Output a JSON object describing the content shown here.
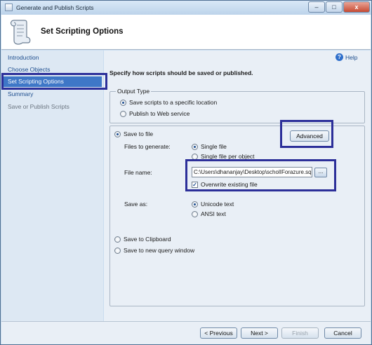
{
  "window": {
    "title": "Generate and Publish Scripts",
    "minimize_glyph": "–",
    "maximize_glyph": "□",
    "close_glyph": "x"
  },
  "header": {
    "title": "Set Scripting Options"
  },
  "sidebar": {
    "items": [
      {
        "label": "Introduction",
        "state": "link"
      },
      {
        "label": "Choose Objects",
        "state": "link"
      },
      {
        "label": "Set Scripting Options",
        "state": "active"
      },
      {
        "label": "Summary",
        "state": "link"
      },
      {
        "label": "Save or Publish Scripts",
        "state": "disabled"
      }
    ]
  },
  "help": {
    "label": "Help",
    "glyph": "?"
  },
  "instruction": "Specify how scripts should be saved or published.",
  "output_type": {
    "legend": "Output Type",
    "options": [
      {
        "label": "Save scripts to a specific location",
        "selected": true
      },
      {
        "label": "Publish to Web service",
        "selected": false
      }
    ]
  },
  "save_options": {
    "save_to_file": "Save to file",
    "advanced_button": "Advanced",
    "files_to_generate_label": "Files to generate:",
    "single_file": "Single file",
    "single_file_per_object": "Single file per object",
    "file_name_label": "File name:",
    "file_name_value": "C:\\Users\\dhananjay\\Desktop\\scholIForazure.sql",
    "browse_glyph": "...",
    "overwrite_label": "Overwrite existing file",
    "overwrite_checked": true,
    "check_glyph": "✓",
    "save_as_label": "Save as:",
    "unicode_text": "Unicode text",
    "ansi_text": "ANSI text",
    "save_to_clipboard": "Save to Clipboard",
    "save_to_new_query_window": "Save to new query window"
  },
  "footer": {
    "previous": "< Previous",
    "next": "Next >",
    "finish": "Finish",
    "cancel": "Cancel"
  },
  "colors": {
    "accent": "#3e77c7",
    "highlight_box": "#2c2f99",
    "link": "#1f4f8f"
  }
}
